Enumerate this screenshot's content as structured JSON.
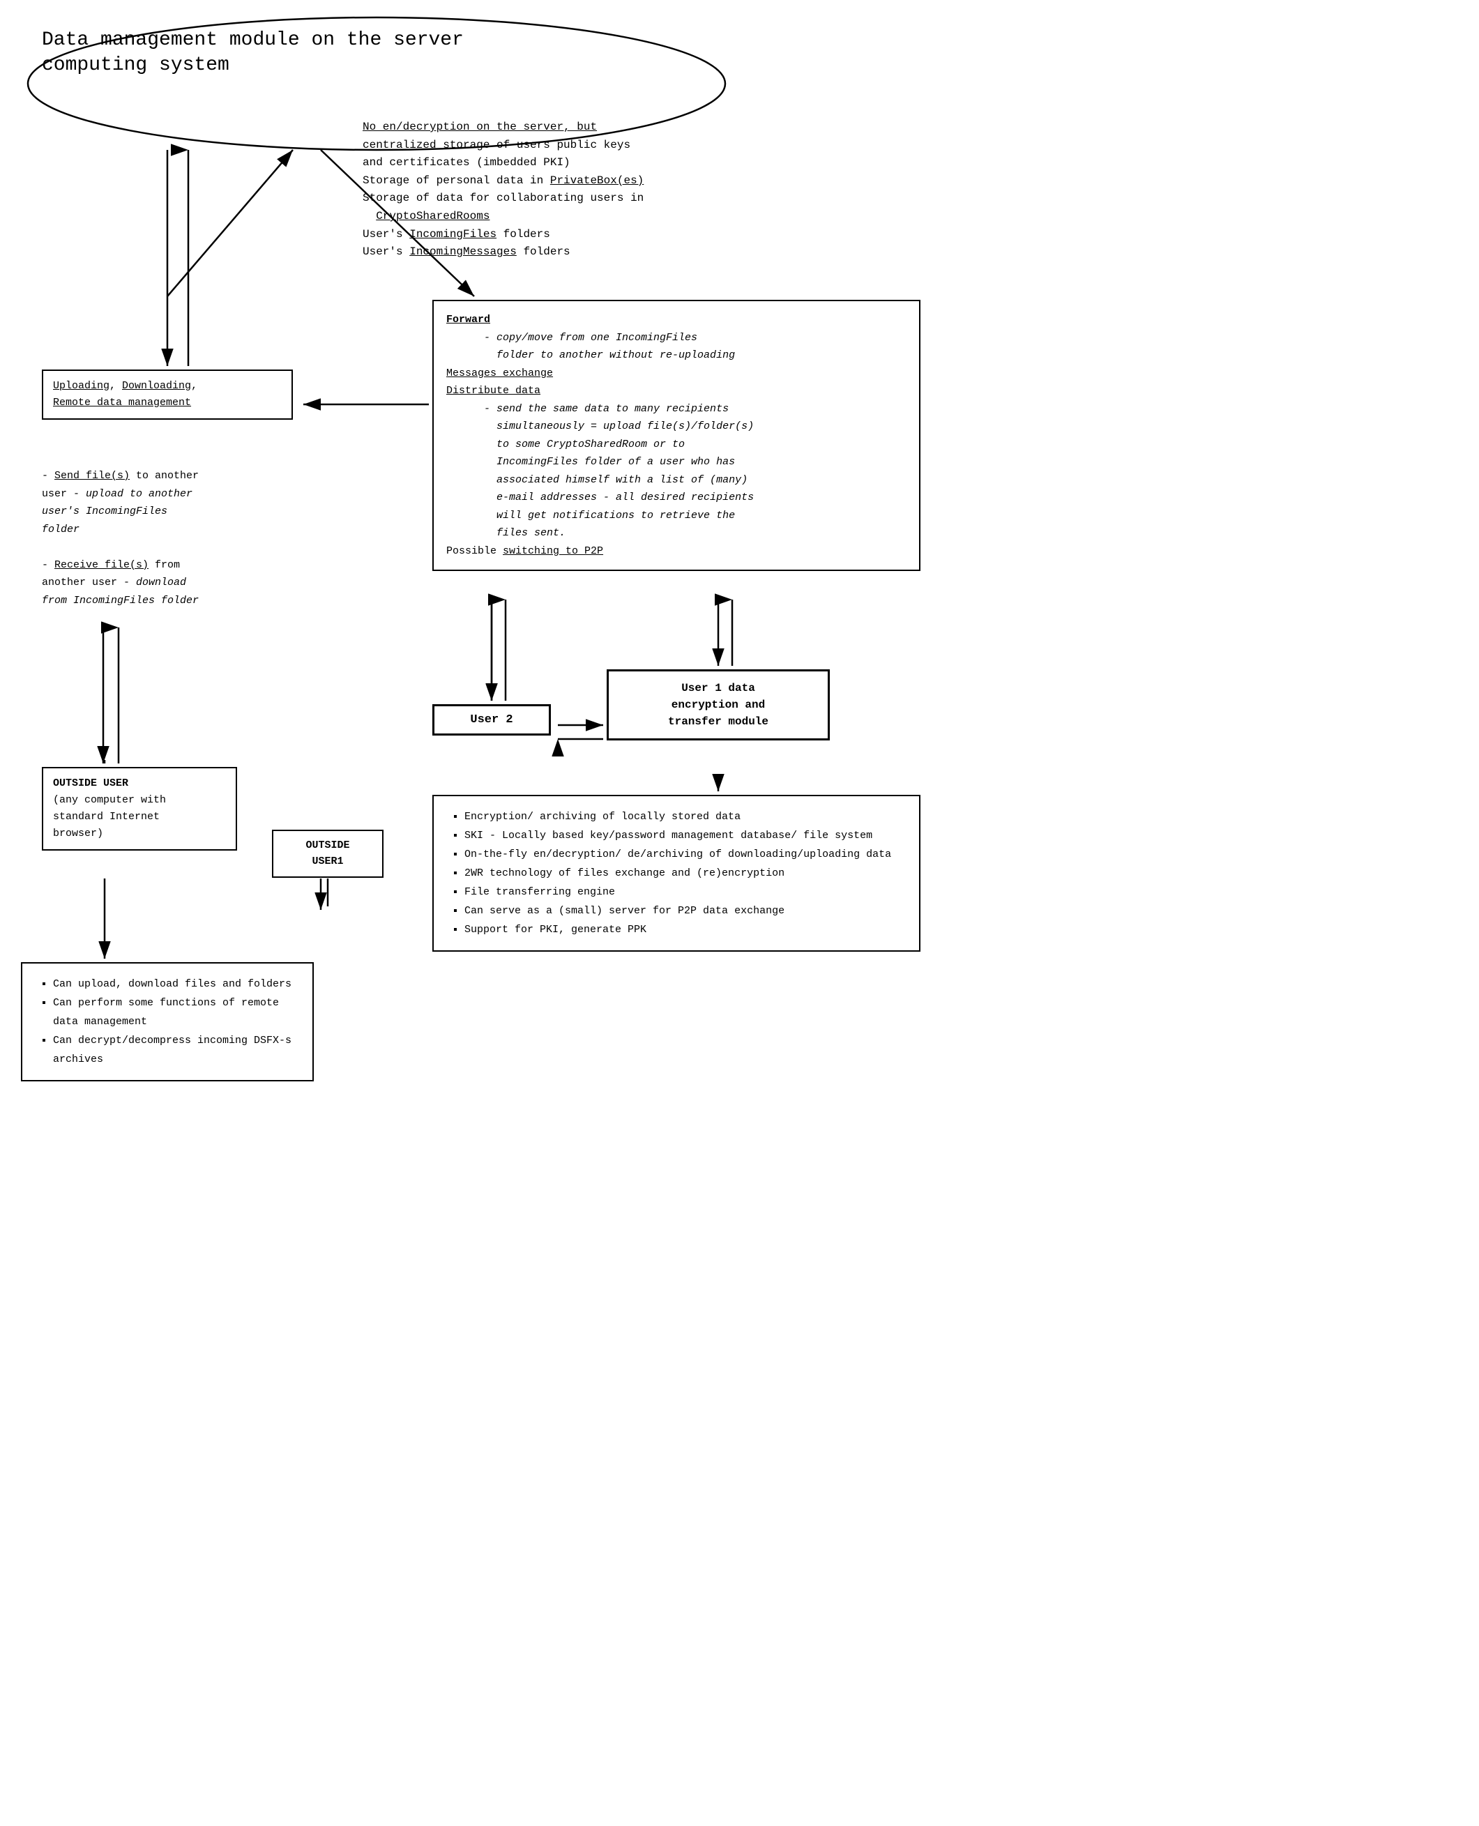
{
  "page": {
    "title": "Data management module on the server computing system"
  },
  "server_module": {
    "title_line1": "Data management module on the server",
    "title_line2": "computing system"
  },
  "server_desc": {
    "line1": "No en/decryption on the server, but",
    "line2": "  centralized storage of users public keys",
    "line3": "  and certificates (imbedded PKI)",
    "line4": "Storage of personal data in PrivateBox(es)",
    "line5": "Storage of data for collaborating users in",
    "line6": "  CryptoSharedRooms",
    "line7": "User's IncomingFiles folders",
    "line8": "User's IncomingMessages folders"
  },
  "upload_box": {
    "title": "Uploading, Downloading,",
    "title2": "Remote data management"
  },
  "send_receive": {
    "line1": "- Send file(s) to another",
    "line2": "user - upload to another",
    "line3": "user's IncomingFiles",
    "line4": "folder",
    "line5": "",
    "line6": "- Receive file(s) from",
    "line7": "another user - download",
    "line8": "from IncomingFiles folder"
  },
  "forward_box": {
    "forward_label": "Forward",
    "forward_desc": "     - copy/move from one IncomingFiles",
    "forward_desc2": "       folder to another without re-uploading",
    "messages_label": "Messages exchange",
    "distribute_label": "Distribute data",
    "distribute_desc1": "     - send the same data to many recipients",
    "distribute_desc2": "       simultaneously = upload file(s)/folder(s)",
    "distribute_desc3": "       to some CryptoSharedRoom or to",
    "distribute_desc4": "       IncomingFiles folder of a user who has",
    "distribute_desc5": "       associated himself with a list of (many)",
    "distribute_desc6": "       e-mail addresses - all desired recipients",
    "distribute_desc7": "       will get notifications to retrieve the",
    "distribute_desc8": "       files sent.",
    "p2p_label": "Possible switching to P2P"
  },
  "outside_user_box": {
    "title": "OUTSIDE USER",
    "desc1": "(any computer with",
    "desc2": "standard Internet",
    "desc3": "browser)"
  },
  "outside_user1_box": {
    "title": "OUTSIDE",
    "title2": "USER1"
  },
  "user2_box": {
    "label": "User 2"
  },
  "user1_enc_box": {
    "line1": "User 1 data",
    "line2": "encryption and",
    "line3": "transfer module"
  },
  "bullet_box_right": {
    "items": [
      "Encryption/ archiving of locally stored data",
      "SKI - Locally based key/password management database/ file system",
      "On-the-fly en/decryption/ de/archiving of downloading/uploading data",
      "2WR technology of files exchange and (re)encryption",
      "File transferring engine",
      "Can serve as a (small) server for P2P data exchange",
      "Support for PKI, generate PPK"
    ]
  },
  "bullet_box_left": {
    "items": [
      "Can upload, download files and folders",
      "Can perform some functions of remote data management",
      "Can decrypt/decompress incoming DSFX-s archives"
    ]
  }
}
